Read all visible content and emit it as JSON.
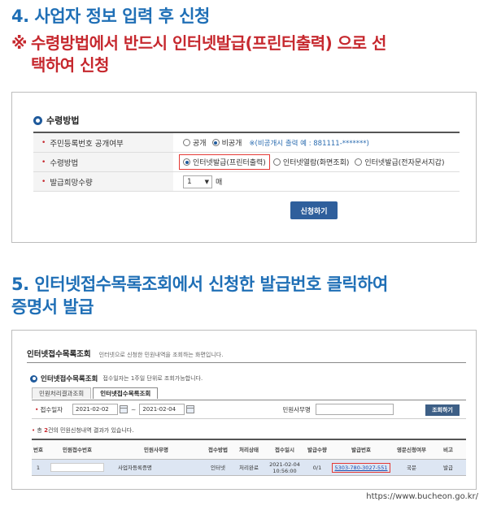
{
  "step4": {
    "title": "4. 사업자 정보 입력 후 신청"
  },
  "notice": {
    "mark": "※",
    "line1": "수령방법에서 반드시 인터넷발급(프린터출력) 으로 선",
    "line2": "택하여 신청"
  },
  "panel1": {
    "section_title": "수령방법",
    "rows": [
      {
        "label": "주민등록번호 공개여부",
        "options": [
          "공개",
          "비공개"
        ],
        "selected": 1,
        "hint": "※(비공개시 출력 예 : 881111-*******)"
      },
      {
        "label": "수령방법",
        "options": [
          "인터넷발급(프린터출력)",
          "인터넷열람(화면조회)",
          "인터넷발급(전자문서지갑)"
        ],
        "selected": 0
      },
      {
        "label": "발급희망수량",
        "quantity": "1",
        "unit": "매"
      }
    ],
    "apply_button": "신청하기"
  },
  "step5": {
    "title_line1": "5. 인터넷접수목록조회에서 신청한 발급번호 클릭하여",
    "title_line2": "증명서 발급"
  },
  "panel2": {
    "header_title": "인터넷접수목록조회",
    "header_desc": "인터넷으로 신청한 민원내역을 조회하는 화면입니다.",
    "section_title": "인터넷접수목록조회",
    "section_desc": "접수일자는 1주일 단위로 조회가능합니다.",
    "tabs": [
      "민원처리결과조회",
      "인터넷접수목록조회"
    ],
    "active_tab": 1,
    "search": {
      "date_label": "접수일자",
      "date_from": "2021-02-02",
      "date_sep": "~",
      "date_to": "2021-02-04",
      "doc_label": "민원사무명",
      "button": "조회하기"
    },
    "result_prefix": "총",
    "result_count": "2",
    "result_suffix": "건의 민원신청내역 결과가 있습니다.",
    "columns": [
      "번호",
      "민원접수번호",
      "민원사무명",
      "접수방법",
      "처리상태",
      "접수일시",
      "발급수량",
      "발급번호",
      "영문신청여부",
      "비고"
    ],
    "rows": [
      {
        "no": "1",
        "receipt_no": "",
        "doc_name": "사업자등록증명",
        "method": "인터넷",
        "status": "처리완료",
        "date": "2021-02-04",
        "time": "10:56:00",
        "qty": "0/1",
        "issue_no": "5303-780-3027-551",
        "english": "국문",
        "note": "발급"
      }
    ]
  },
  "source": "https://www.bucheon.go.kr/"
}
